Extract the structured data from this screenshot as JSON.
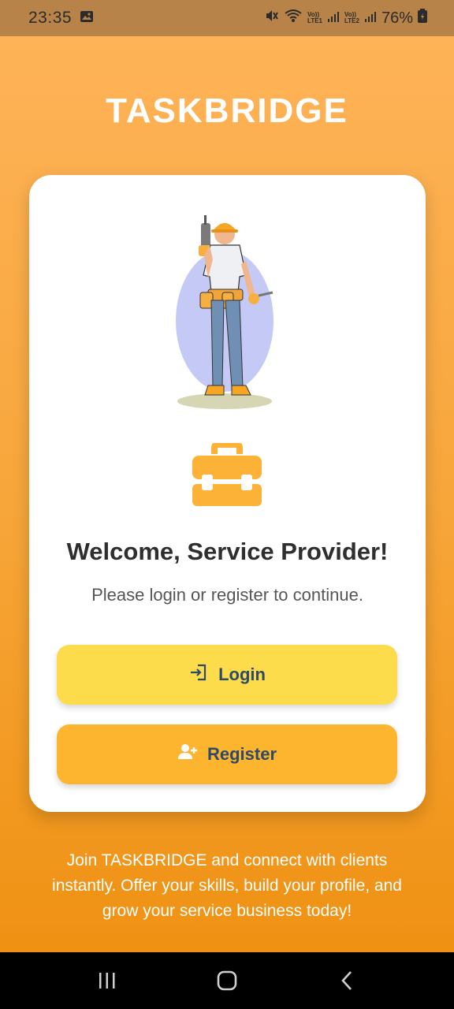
{
  "status_bar": {
    "time": "23:35",
    "sim1": [
      "Vo))",
      "LTE1"
    ],
    "sim2": [
      "Vo))",
      "LTE2"
    ],
    "battery": "76%",
    "icons": [
      "gallery-icon",
      "mute-icon",
      "wifi-icon",
      "signal-icon",
      "battery-icon"
    ]
  },
  "app_title": "TASKBRIDGE",
  "card": {
    "welcome": "Welcome, Service Provider!",
    "subtitle": "Please login or register to continue.",
    "login_label": "Login",
    "register_label": "Register"
  },
  "footer_text": "Join TASKBRIDGE and connect with clients instantly. Offer your skills, build your profile, and grow your service business today!",
  "colors": {
    "accent_orange": "#f7a63a",
    "login_button": "#fddc4b",
    "register_button": "#fdb52f",
    "button_text": "#2f4a66",
    "toolbox": "#fbb237"
  }
}
